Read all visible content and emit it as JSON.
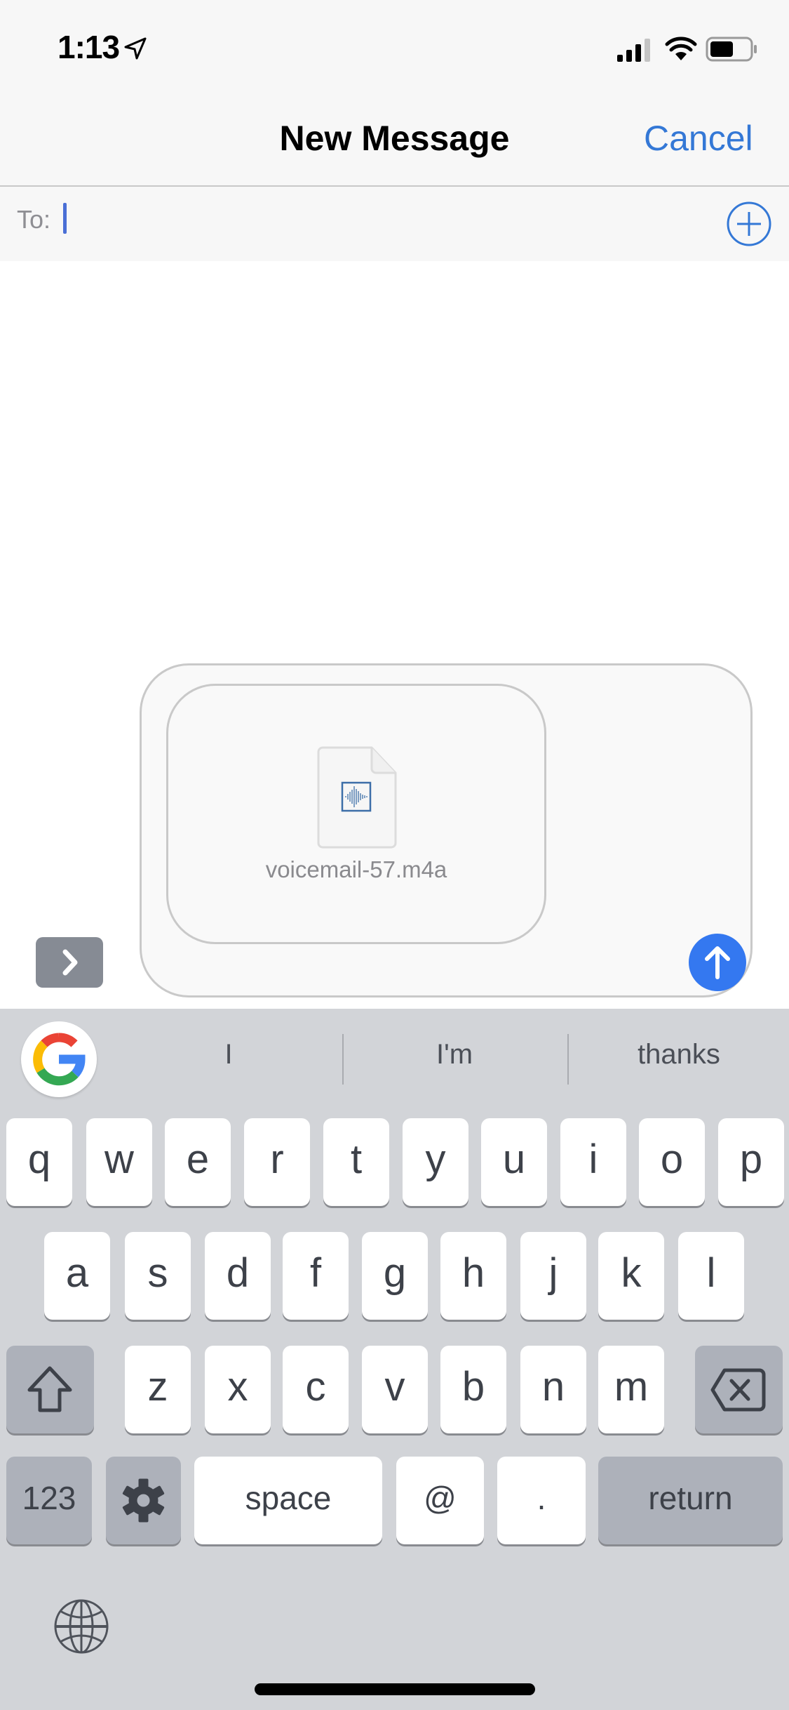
{
  "status_bar": {
    "time": "1:13",
    "icons": [
      "location-arrow-icon",
      "cellular-signal-icon",
      "wifi-icon",
      "battery-icon"
    ]
  },
  "nav": {
    "title": "New Message",
    "cancel_label": "Cancel",
    "accent_color": "#3478d6"
  },
  "to_field": {
    "label": "To:",
    "value": "",
    "add_icon": "plus-circle-icon"
  },
  "compose": {
    "attachment": {
      "file_name": "voicemail-57.m4a",
      "icon": "audio-file-icon"
    },
    "send_icon": "arrow-up-icon",
    "send_color": "#3478f0",
    "expand_icon": "chevron-right-icon"
  },
  "keyboard": {
    "suggestions": [
      "I",
      "I'm",
      "thanks"
    ],
    "google_icon": "google-g-icon",
    "row1": [
      "q",
      "w",
      "e",
      "r",
      "t",
      "y",
      "u",
      "i",
      "o",
      "p"
    ],
    "row2": [
      "a",
      "s",
      "d",
      "f",
      "g",
      "h",
      "j",
      "k",
      "l"
    ],
    "row3": [
      "z",
      "x",
      "c",
      "v",
      "b",
      "n",
      "m"
    ],
    "shift_icon": "shift-icon",
    "delete_icon": "backspace-icon",
    "numbers_label": "123",
    "settings_icon": "gear-icon",
    "space_label": "space",
    "at_label": "@",
    "period_label": ".",
    "return_label": "return",
    "globe_icon": "globe-icon"
  }
}
